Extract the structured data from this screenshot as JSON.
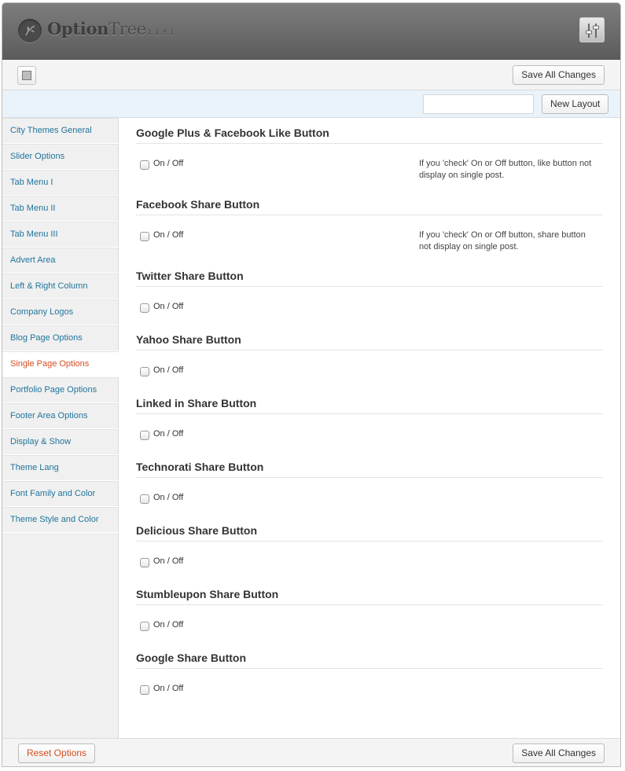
{
  "header": {
    "brand_bold": "Option",
    "brand_light": "Tree",
    "version": "1.1.8.1",
    "logo_icon": "leaf-icon",
    "settings_icon": "sliders-icon"
  },
  "toolbar": {
    "save_label": "Save All Changes",
    "doc_icon": "document-icon"
  },
  "layout": {
    "input_value": "",
    "new_layout_label": "New Layout"
  },
  "sidebar": {
    "items": [
      {
        "label": "City Themes General"
      },
      {
        "label": "Slider Options"
      },
      {
        "label": "Tab Menu I"
      },
      {
        "label": "Tab Menu II"
      },
      {
        "label": "Tab Menu III"
      },
      {
        "label": "Advert Area"
      },
      {
        "label": "Left & Right Column"
      },
      {
        "label": "Company Logos"
      },
      {
        "label": "Blog Page Options"
      },
      {
        "label": "Single Page Options"
      },
      {
        "label": "Portfolio Page Options"
      },
      {
        "label": "Footer Area Options"
      },
      {
        "label": "Display & Show"
      },
      {
        "label": "Theme Lang"
      },
      {
        "label": "Font Family and Color"
      },
      {
        "label": "Theme Style and Color"
      }
    ],
    "active_index": 9
  },
  "sections": [
    {
      "title": "Google Plus & Facebook Like Button",
      "option": "On / Off",
      "checked": false,
      "desc": "If you 'check' On or Off button, like button not display on single post."
    },
    {
      "title": "Facebook Share Button",
      "option": "On / Off",
      "checked": false,
      "desc": "If you 'check' On or Off button, share button not display on single post."
    },
    {
      "title": "Twitter Share Button",
      "option": "On / Off",
      "checked": false,
      "desc": ""
    },
    {
      "title": "Yahoo Share Button",
      "option": "On / Off",
      "checked": false,
      "desc": ""
    },
    {
      "title": "Linked in Share Button",
      "option": "On / Off",
      "checked": false,
      "desc": ""
    },
    {
      "title": "Technorati Share Button",
      "option": "On / Off",
      "checked": false,
      "desc": ""
    },
    {
      "title": "Delicious Share Button",
      "option": "On / Off",
      "checked": false,
      "desc": ""
    },
    {
      "title": "Stumbleupon Share Button",
      "option": "On / Off",
      "checked": false,
      "desc": ""
    },
    {
      "title": "Google Share Button",
      "option": "On / Off",
      "checked": false,
      "desc": ""
    }
  ],
  "footer": {
    "reset_label": "Reset Options",
    "save_label": "Save All Changes"
  },
  "colors": {
    "link": "#21759b",
    "active": "#d54e21"
  }
}
